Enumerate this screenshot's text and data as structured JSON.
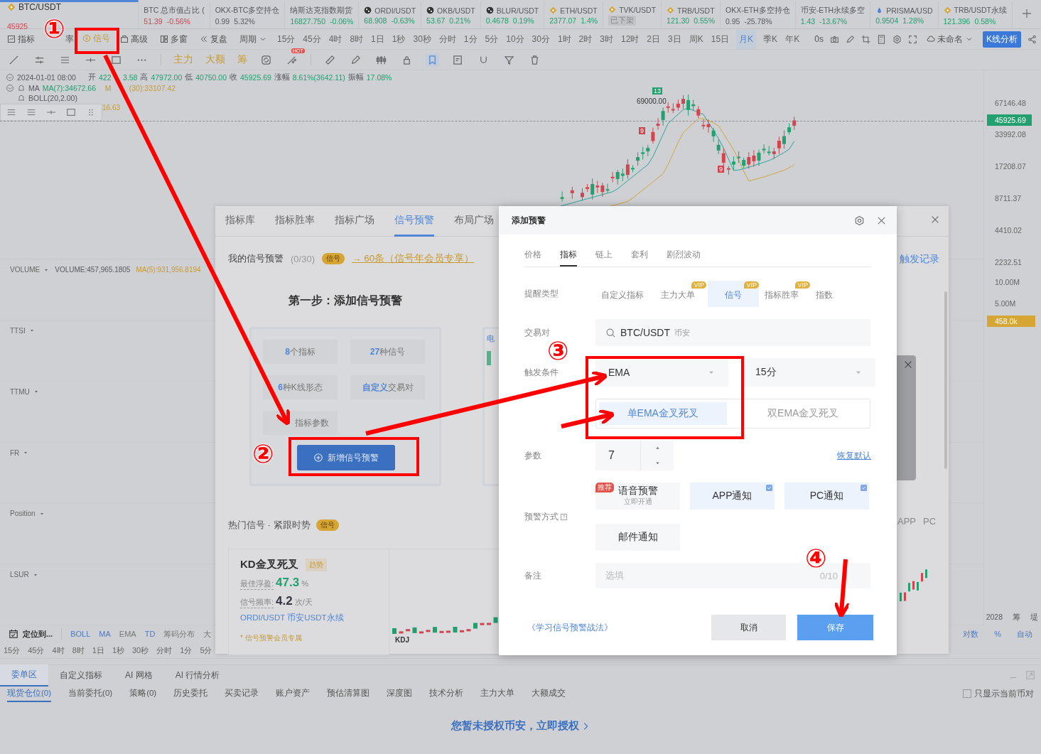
{
  "tickers": [
    {
      "name": "BTC/USDT",
      "price": "45925",
      "color": "#d2454e",
      "selected": true
    },
    {
      "name": "BTC 总市值占比 (",
      "price": "51.39",
      "change": "-0.56%",
      "color": "#d2454e",
      "selected": false
    },
    {
      "name": "OKX-BTC多空持仓",
      "price": "0.99",
      "change": "5.32%",
      "color": "#555a60",
      "selected": false
    },
    {
      "name": "纳斯达克指数期货",
      "price": "16827.750",
      "change": "-0.06%",
      "color": "#22a06f",
      "selected": false
    },
    {
      "name": "ORDI/USDT",
      "price": "68.908",
      "change": "-0.63%",
      "color": "#22a06f",
      "selected": false
    },
    {
      "name": "OKB/USDT",
      "price": "53.67",
      "change": "0.21%",
      "color": "#22a06f",
      "selected": false
    },
    {
      "name": "BLUR/USDT",
      "price": "0.4678",
      "change": "0.19%",
      "color": "#22a06f",
      "selected": false
    },
    {
      "name": "ETH/USDT",
      "price": "2377.07",
      "change": "1.4%",
      "color": "#22a06f",
      "selected": false
    },
    {
      "name": "TVK/USDT",
      "badge": "已下架",
      "selected": false
    },
    {
      "name": "TRB/USDT",
      "price": "121.30",
      "change": "0.55%",
      "color": "#22a06f",
      "selected": false
    },
    {
      "name": "OKX-ETH多空持仓",
      "price": "0.95",
      "change": "-25.78%",
      "color": "#555a60",
      "selected": false
    },
    {
      "name": "币安-ETH永续多空",
      "price": "1.43",
      "change": "-13.67%",
      "color": "#22a06f",
      "selected": false
    },
    {
      "name": "PRISMA/USD",
      "price": "0.9504",
      "change": "1.28%",
      "color": "#22a06f",
      "selected": false
    },
    {
      "name": "TRB/USDT永续",
      "price": "121.396",
      "change": "0.58%",
      "color": "#22a06f",
      "selected": false
    }
  ],
  "tools": [
    {
      "label": "指标",
      "selected": false
    },
    {
      "label": "率",
      "selected": false
    },
    {
      "label": "信号",
      "selected": true
    },
    {
      "label": "高级",
      "selected": false
    },
    {
      "label": "多窗",
      "selected": false
    },
    {
      "label": "复盘",
      "selected": false
    },
    {
      "label": "周期",
      "selected": false
    }
  ],
  "periods": [
    {
      "label": "15分",
      "selected": false
    },
    {
      "label": "45分",
      "selected": false
    },
    {
      "label": "4时",
      "selected": false
    },
    {
      "label": "8时",
      "selected": false
    },
    {
      "label": "1日",
      "selected": false
    },
    {
      "label": "1秒",
      "selected": false
    },
    {
      "label": "30秒",
      "selected": false
    },
    {
      "label": "分时",
      "selected": false
    },
    {
      "label": "1分",
      "selected": false
    },
    {
      "label": "5分",
      "selected": false
    },
    {
      "label": "10分",
      "selected": false
    },
    {
      "label": "30分",
      "selected": false
    },
    {
      "label": "1时",
      "selected": false
    },
    {
      "label": "2时",
      "selected": false
    },
    {
      "label": "3时",
      "selected": false
    },
    {
      "label": "12时",
      "selected": false
    },
    {
      "label": "2日",
      "selected": false
    },
    {
      "label": "3日",
      "selected": false
    },
    {
      "label": "周K",
      "selected": false
    },
    {
      "label": "15日",
      "selected": false
    },
    {
      "label": "月K",
      "selected": true
    },
    {
      "label": "季K",
      "selected": false
    },
    {
      "label": "年K",
      "selected": false
    }
  ],
  "timer": "0s",
  "layout_name": "未命名",
  "analysis_button": "K线分析",
  "drawing_tools": [
    {
      "selected": false
    },
    {
      "selected": false
    },
    {
      "selected": false
    },
    {
      "selected": false
    },
    {
      "selected": false
    },
    {
      "selected": false
    },
    {
      "selected": false
    },
    {
      "selected": false
    },
    {
      "selected": false
    },
    {
      "selected": false
    },
    {
      "selected": false
    },
    {
      "selected": false
    },
    {
      "selected": true
    },
    {
      "selected": false
    },
    {
      "selected": false
    },
    {
      "selected": false
    },
    {
      "selected": false
    }
  ],
  "quick_labels": [
    "主力",
    "大额",
    "筹"
  ],
  "hot_badge": "HOT",
  "chart_info": {
    "date": "2024-01-01 08:00",
    "ohlc": [
      {
        "label": "开",
        "value": "422"
      },
      {
        "value": "3.58"
      },
      {
        "label": "高",
        "value": "47972.00"
      },
      {
        "label": "低",
        "value": "40750.00"
      },
      {
        "label": "收",
        "value": "45925.69"
      },
      {
        "label": "涨幅",
        "value": "8.61%(3642.11)"
      },
      {
        "label": "振幅",
        "value": "17.08%"
      }
    ],
    "ma_name": "MA",
    "ma_values": [
      "MA(7):34672.66",
      "M",
      "(30):33107.42"
    ],
    "boll": "BOLL(20,2.00)",
    "float_value": "16.63"
  },
  "peak_label": "69000.00",
  "markers": [
    {
      "label": "13"
    },
    {
      "label": "9"
    },
    {
      "label": "9"
    }
  ],
  "axis_labels": [
    {
      "label": "67146.48",
      "kind": "plain"
    },
    {
      "label": "45925.69",
      "kind": "current"
    },
    {
      "label": "33992.08",
      "kind": "plain"
    },
    {
      "label": "17208.07",
      "kind": "plain"
    },
    {
      "label": "8711.37",
      "kind": "plain"
    },
    {
      "label": "4410.02",
      "kind": "plain"
    },
    {
      "label": "2232.51",
      "kind": "plain"
    },
    {
      "label": "10.00M",
      "kind": "plain"
    },
    {
      "label": "5.00M",
      "kind": "plain"
    },
    {
      "label": "458.0k",
      "kind": "volume"
    }
  ],
  "indicators": [
    {
      "name": "VOLUME",
      "readings": [
        "VOLUME:457,965.1805",
        "MA(5):931,956.8194"
      ]
    },
    {
      "name": "TTSI"
    },
    {
      "name": "TTMU"
    },
    {
      "name": "FR"
    },
    {
      "name": "Position"
    },
    {
      "name": "LSUR"
    }
  ],
  "axis_footer": {
    "year": "2028",
    "tools": [
      "筹",
      "堤"
    ]
  },
  "indicator_bar": {
    "locate": "定位到...",
    "items": [
      {
        "label": "BOLL",
        "on": true
      },
      {
        "label": "MA",
        "on": true
      },
      {
        "label": "EMA",
        "on": false
      },
      {
        "label": "TD",
        "on": true
      },
      {
        "label": "筹码分布",
        "on": false
      },
      {
        "label": "大",
        "on": false
      }
    ],
    "scale_options": [
      "对数",
      "%",
      "自动"
    ]
  },
  "bottom_periods": [
    "15分",
    "45分",
    "4时",
    "8时",
    "1日",
    "1秒",
    "30秒",
    "分时",
    "1分",
    "5分"
  ],
  "bottom_panel": {
    "tabs": [
      {
        "label": "委单区",
        "selected": true
      },
      {
        "label": "自定义指标",
        "selected": false
      },
      {
        "label": "AI 网格",
        "selected": false
      },
      {
        "label": "AI 行情分析",
        "selected": false
      }
    ],
    "subtabs": [
      {
        "label": "现货仓位(0)",
        "selected": true
      },
      {
        "label": "当前委托(0)",
        "selected": false
      },
      {
        "label": "策略(0)",
        "selected": false
      },
      {
        "label": "历史委托",
        "selected": false
      },
      {
        "label": "买卖记录",
        "selected": false
      },
      {
        "label": "账户资产",
        "selected": false
      },
      {
        "label": "预估清算图",
        "selected": false
      },
      {
        "label": "深度图",
        "selected": false
      },
      {
        "label": "技术分析",
        "selected": false
      },
      {
        "label": "主力大单",
        "selected": false
      },
      {
        "label": "大额成交",
        "selected": false
      }
    ],
    "filter": {
      "label": "只显示当前币对",
      "checked": false
    },
    "notice": "您暂未授权币安，立即授权"
  },
  "signal_panel": {
    "tabs": [
      {
        "label": "指标库",
        "selected": false
      },
      {
        "label": "指标胜率",
        "selected": false
      },
      {
        "label": "指标广场",
        "selected": false
      },
      {
        "label": "信号预警",
        "selected": true
      },
      {
        "label": "布局广场",
        "selected": false
      }
    ],
    "title": "我的信号预警",
    "count": "(0/30)",
    "badge": "信号",
    "upgrade_link": "→ 60条（信号年会员专享）",
    "step_title": "第一步：添加信号预警",
    "features": [
      {
        "highlight": "8",
        "rest": "个指标"
      },
      {
        "highlight": "27",
        "rest": "种信号"
      },
      {
        "highlight": "6",
        "rest": "种K线形态"
      },
      {
        "highlight": "自定义",
        "rest": "交易对"
      },
      {
        "rest": "指标参数"
      }
    ],
    "add_button": "新增信号预警",
    "side_card_text": "电",
    "hot_title": "热门信号 · 紧跟时势",
    "hot_badge": "信号",
    "card": {
      "title": "KD金叉死叉",
      "tag": "趋势",
      "stats": [
        {
          "label": "最佳浮盈:",
          "value": "47.3",
          "unit": "%",
          "kind": "profit"
        },
        {
          "label": "信号频率:",
          "value": "4.2",
          "unit": "次/天",
          "kind": "plain"
        }
      ],
      "pair": "ORDI/USDT 币安USDT永续",
      "note": "* 信号预警会员专属",
      "chart_label": "KDJ"
    },
    "trigger_log": "触发记录",
    "channels": [
      "APP",
      "PC"
    ]
  },
  "dialog": {
    "title": "添加预警",
    "tabs": [
      {
        "label": "价格",
        "selected": false
      },
      {
        "label": "指标",
        "selected": true
      },
      {
        "label": "链上",
        "selected": false
      },
      {
        "label": "套利",
        "selected": false
      },
      {
        "label": "剧烈波动",
        "selected": false
      }
    ],
    "type_label": "提醒类型",
    "types": [
      {
        "label": "自定义指标",
        "selected": false
      },
      {
        "label": "主力大单",
        "badge": "VIP",
        "selected": false
      },
      {
        "label": "信号",
        "badge": "VIP",
        "selected": true
      },
      {
        "label": "指标胜率",
        "badge": "VIP",
        "selected": false
      },
      {
        "label": "指数",
        "selected": false
      }
    ],
    "pair_label": "交易对",
    "pair": "BTC/USDT",
    "exchange": "币安",
    "condition_label": "触发条件",
    "indicator": "EMA",
    "interval": "15分",
    "modes": [
      {
        "label": "单EMA金叉死叉",
        "selected": true
      },
      {
        "label": "双EMA金叉死叉",
        "selected": false
      }
    ],
    "param_label": "参数",
    "param": "7",
    "reset_link": "恢复默认",
    "method_label": "预警方式",
    "methods": [
      {
        "label": "语音预警",
        "sub": "立即开通",
        "tag": "推荐",
        "checked": false
      },
      {
        "label": "APP通知",
        "checked": true
      },
      {
        "label": "PC通知",
        "checked": true
      },
      {
        "label": "邮件通知",
        "checked": false
      }
    ],
    "note_label": "备注",
    "note_placeholder": "选填",
    "note_counter": "0/10",
    "learn_link": "《学习信号预警战法》",
    "cancel": "取消",
    "save": "保存"
  },
  "annotations": {
    "steps": [
      "①",
      "②",
      "③",
      "④"
    ]
  }
}
